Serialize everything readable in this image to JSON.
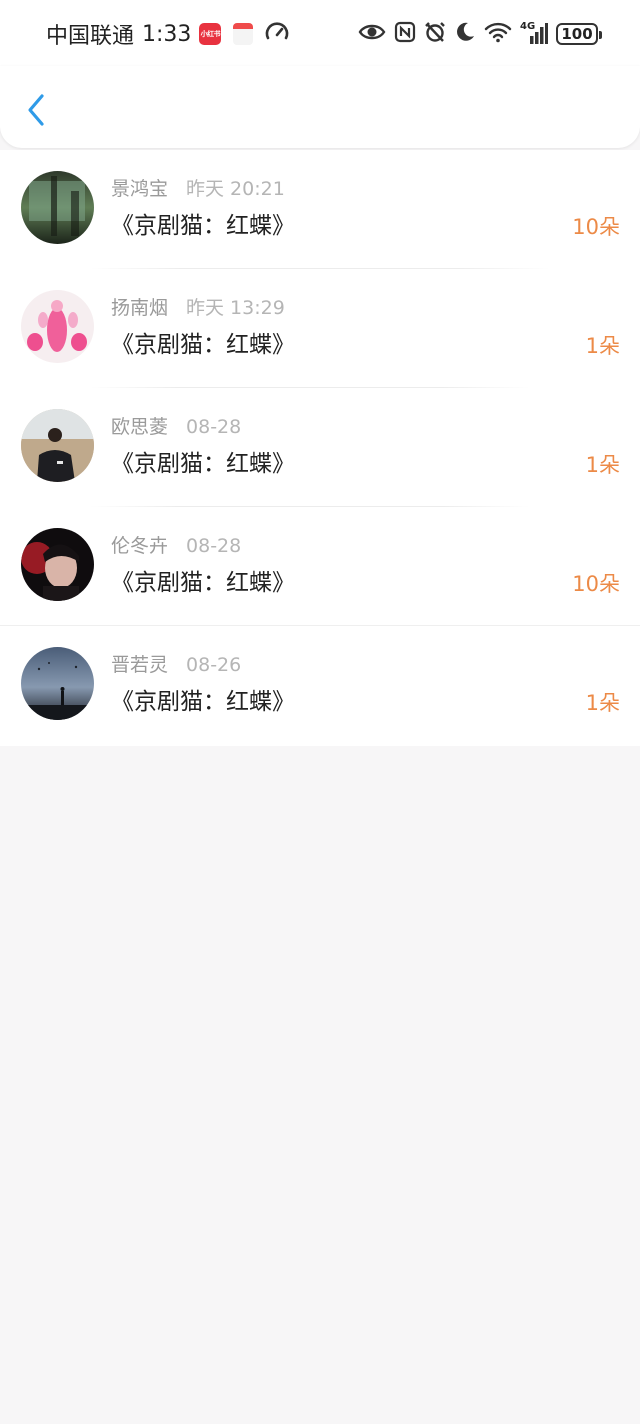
{
  "status_bar": {
    "carrier": "中国联通",
    "time": "1:33",
    "app_badge": "小红书",
    "network": "4G",
    "battery": "100"
  },
  "header": {
    "back_icon": "chevron-left-icon"
  },
  "colors": {
    "accent_blue": "#2f9be8",
    "amount_orange": "#ec8a47",
    "name_gray": "#9a9a9a",
    "time_gray": "#b5b5b5",
    "title_dark": "#222222"
  },
  "records": [
    {
      "name": "景鸿宝",
      "time": "昨天 20:21",
      "title": "《京剧猫：红蝶》",
      "amount": "10朵"
    },
    {
      "name": "扬南烟",
      "time": "昨天 13:29",
      "title": "《京剧猫：红蝶》",
      "amount": "1朵"
    },
    {
      "name": "欧思菱",
      "time": "08-28",
      "title": "《京剧猫：红蝶》",
      "amount": "1朵"
    },
    {
      "name": "伦冬卉",
      "time": "08-28",
      "title": "《京剧猫：红蝶》",
      "amount": "10朵"
    },
    {
      "name": "晋若灵",
      "time": "08-26",
      "title": "《京剧猫：红蝶》",
      "amount": "1朵"
    }
  ]
}
